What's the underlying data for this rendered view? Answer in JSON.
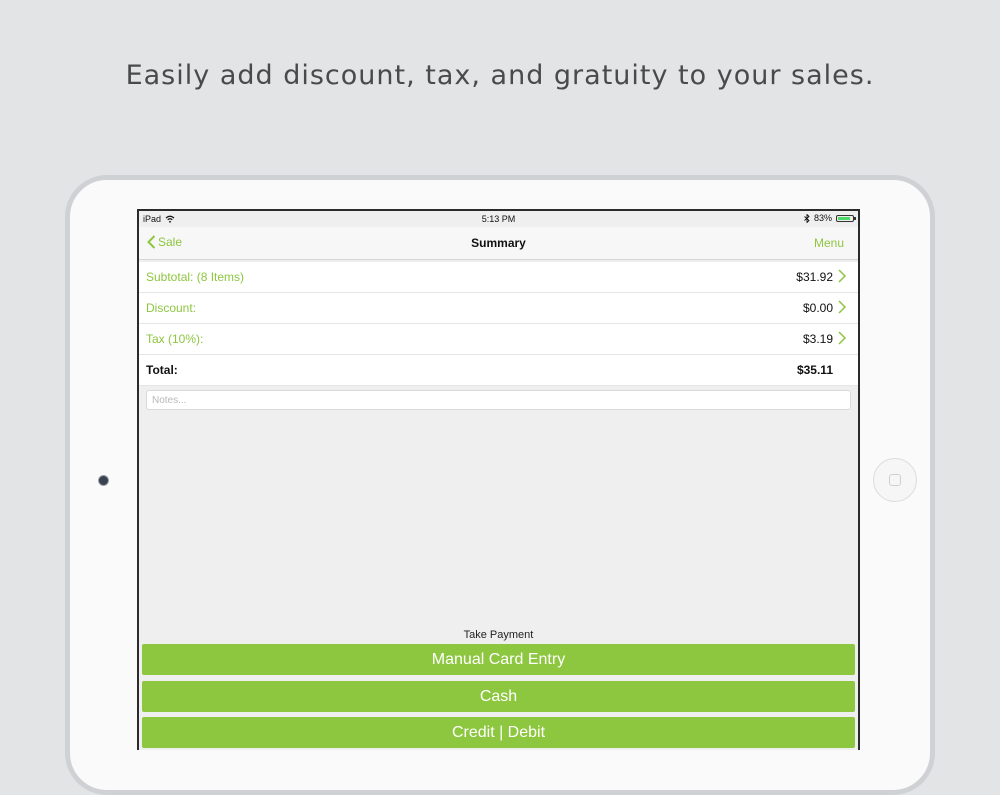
{
  "headline": "Easily add discount, tax, and gratuity to your sales.",
  "statusbar": {
    "device": "iPad",
    "time": "5:13 PM",
    "battery": "83%"
  },
  "navbar": {
    "back_label": "Sale",
    "title": "Summary",
    "menu_label": "Menu"
  },
  "summary_rows": [
    {
      "label": "Subtotal: (8 Items)",
      "value": "$31.92"
    },
    {
      "label": "Discount:",
      "value": "$0.00"
    },
    {
      "label": "Tax (10%):",
      "value": "$3.19"
    },
    {
      "label": "Total:",
      "value": "$35.11"
    }
  ],
  "notes": {
    "placeholder": "Notes..."
  },
  "payment": {
    "heading": "Take Payment",
    "buttons": [
      "Manual Card Entry",
      "Cash",
      "Credit | Debit"
    ]
  },
  "colors": {
    "accent": "#8dc63f",
    "background": "#e3e4e6"
  }
}
